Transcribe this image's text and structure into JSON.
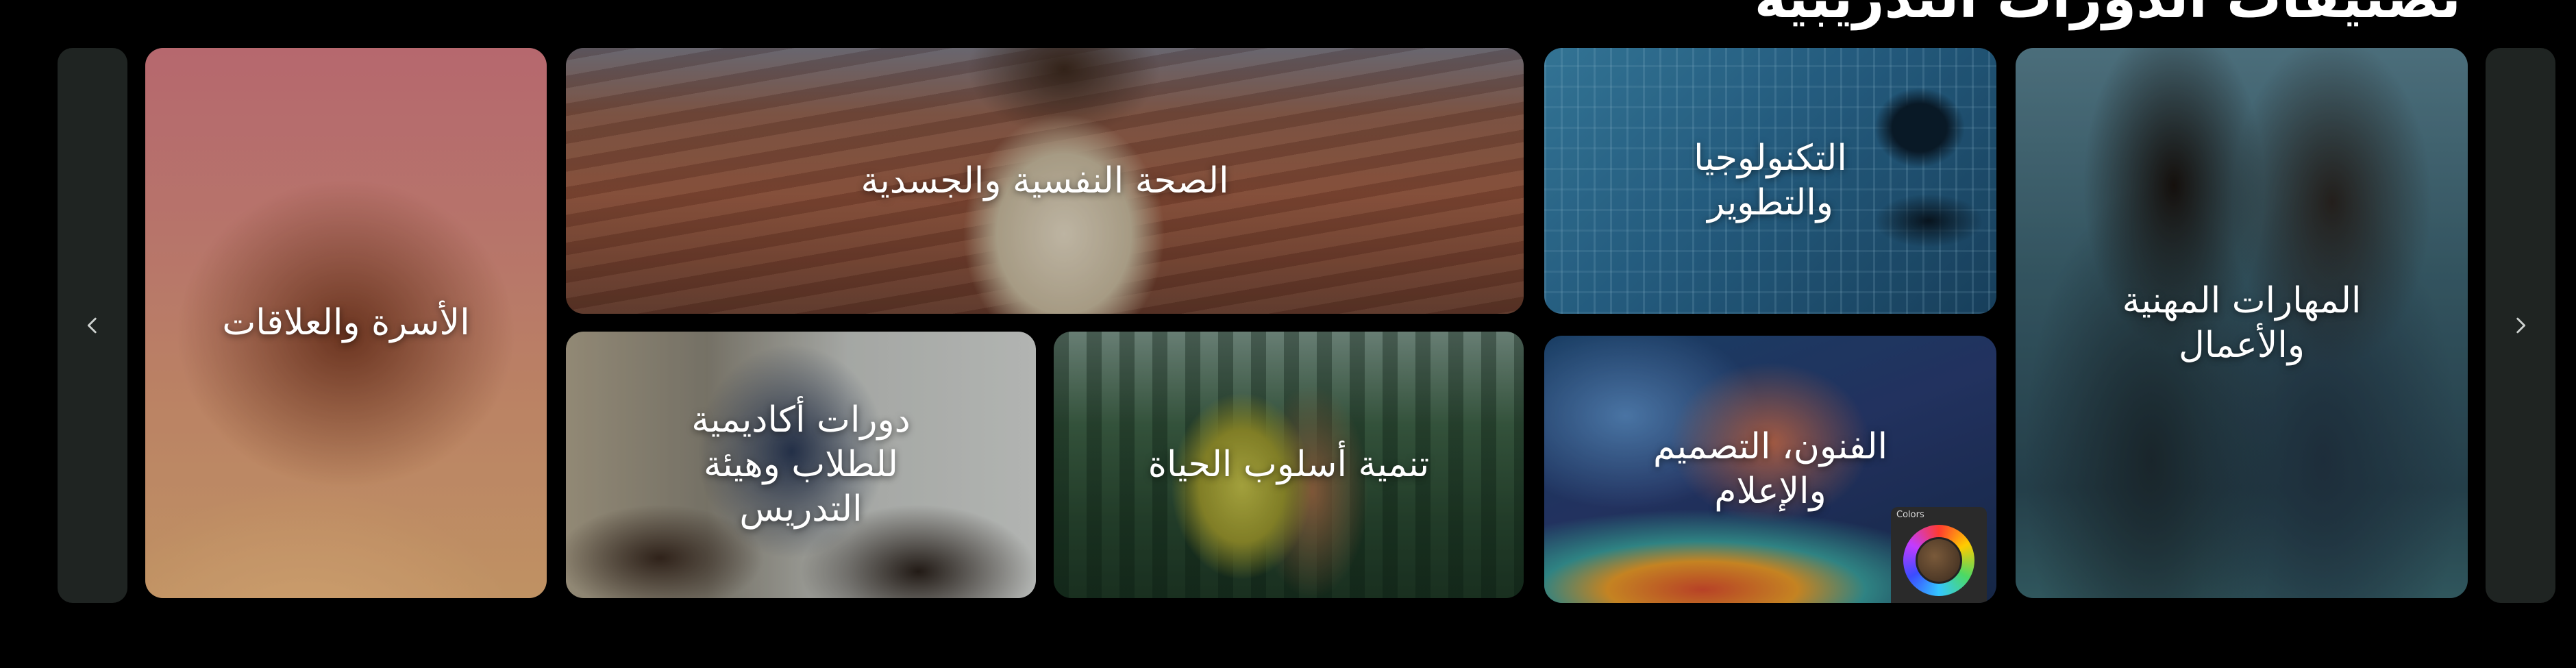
{
  "section": {
    "title": "تصنيفات الدورات التدريبية"
  },
  "carousel": {
    "prev_icon": "chevron-left-icon",
    "next_icon": "chevron-right-icon",
    "cards": {
      "family": {
        "label": "الأسرة والعلاقات"
      },
      "health": {
        "label": "الصحة النفسية والجسدية"
      },
      "tech": {
        "label": "التكنولوجيا والتطوير"
      },
      "business": {
        "label": "المهارات المهنية والأعمال"
      },
      "academic": {
        "label": "دورات أكاديمية للطلاب وهيئة التدريس"
      },
      "lifestyle": {
        "label": "تنمية أسلوب الحياة"
      },
      "arts": {
        "label": "الفنون، التصميم والإعلام",
        "widget_title": "Colors"
      }
    }
  },
  "colors": {
    "background": "#000000",
    "nav_button": "#1f2422",
    "text": "#ffffff"
  }
}
